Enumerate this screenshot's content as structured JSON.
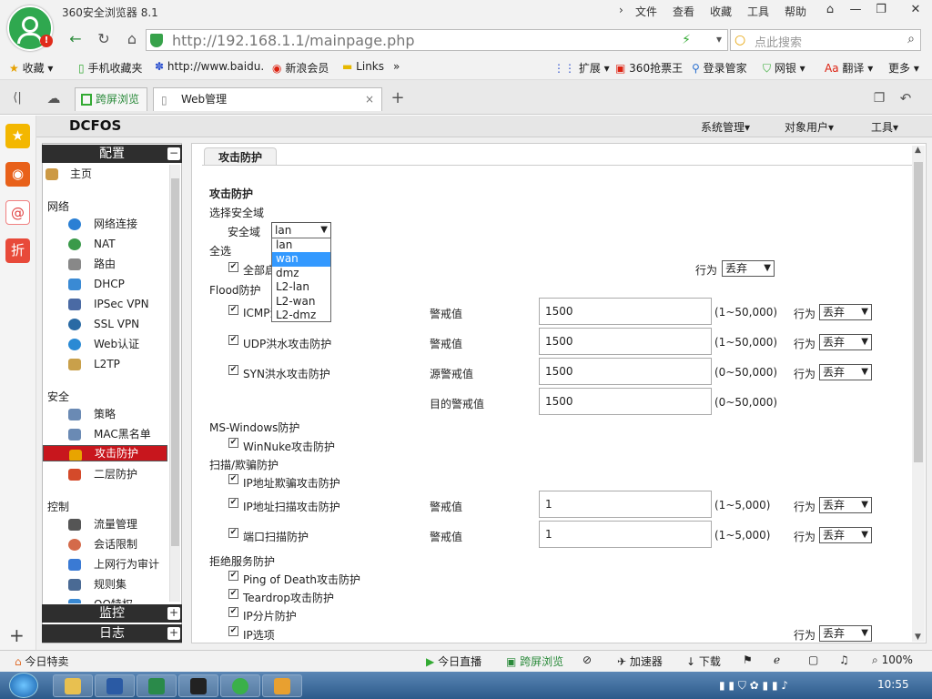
{
  "browser": {
    "title": "360安全浏览器 8.1",
    "menu": [
      "文件",
      "查看",
      "收藏",
      "工具",
      "帮助"
    ],
    "url_host": "http://192.168.1.1",
    "url_path": "/mainpage.php",
    "search_placeholder": "点此搜索",
    "bookmarks": [
      "收藏",
      "手机收藏夹",
      "http://www.baidu.",
      "新浪会员",
      "Links"
    ],
    "extensions": [
      "扩展",
      "360抢票王",
      "登录管家",
      "网银",
      "翻译",
      "更多"
    ],
    "tabs": [
      {
        "label": "跨屏浏览"
      },
      {
        "label": "Web管理"
      }
    ],
    "status_left": "今日特卖",
    "status_items": [
      "今日直播",
      "跨屏浏览",
      "加速器",
      "下载"
    ],
    "zoom": "100%"
  },
  "app": {
    "logo": "DCFOS",
    "top_menu": [
      "系统管理",
      "对象用户",
      "工具"
    ],
    "nav": {
      "config_header": "配置",
      "home": "主页",
      "group_network": "网络",
      "network_items": [
        "网络连接",
        "NAT",
        "路由",
        "DHCP",
        "IPSec VPN",
        "SSL VPN",
        "Web认证",
        "L2TP"
      ],
      "group_security": "安全",
      "security_items": [
        "策略",
        "MAC黑名单",
        "攻击防护",
        "二层防护"
      ],
      "group_control": "控制",
      "control_items": [
        "流量管理",
        "会话限制",
        "上网行为审计",
        "规则集",
        "QQ特权"
      ],
      "monitor_header": "监控",
      "log_header": "日志"
    },
    "panel": {
      "tab": "攻击防护",
      "heading": "攻击防护",
      "select_zone_label": "选择安全域",
      "zone_label": "安全域",
      "zone_value": "lan",
      "zone_options": [
        "lan",
        "wan",
        "dmz",
        "L2-lan",
        "L2-wan",
        "L2-dmz"
      ],
      "zone_highlight": "wan",
      "select_all": "全选",
      "all_enable": "全部启用",
      "all_action_label": "行为",
      "all_action_value": "丢弃",
      "flood": "Flood防护",
      "icmp": "ICMP洪水攻击防护",
      "udp": "UDP洪水攻击防护",
      "syn": "SYN洪水攻击防护",
      "alert": "警戒值",
      "src_alert": "源警戒值",
      "dst_alert": "目的警戒值",
      "icmp_val": "1500",
      "udp_val": "1500",
      "syn_src_val": "1500",
      "syn_dst_val": "1500",
      "range_50k_1": "(1~50,000)",
      "range_50k_0": "(0~50,000)",
      "range_5k": "(1~5,000)",
      "action": "行为",
      "drop": "丢弃",
      "ms_windows": "MS-Windows防护",
      "winnuke": "WinNuke攻击防护",
      "scan": "扫描/欺骗防护",
      "ip_spoof": "IP地址欺骗攻击防护",
      "ip_scan": "IP地址扫描攻击防护",
      "port_scan": "端口扫描防护",
      "ip_scan_val": "1",
      "port_scan_val": "1",
      "dos": "拒绝服务防护",
      "ping_death": "Ping of Death攻击防护",
      "teardrop": "Teardrop攻击防护",
      "ip_frag": "IP分片防护",
      "ip_option": "IP选项"
    }
  },
  "taskbar": {
    "time": "10:55"
  },
  "colors": {
    "accent": "#c8161d",
    "brand_green": "#2fa84f"
  }
}
